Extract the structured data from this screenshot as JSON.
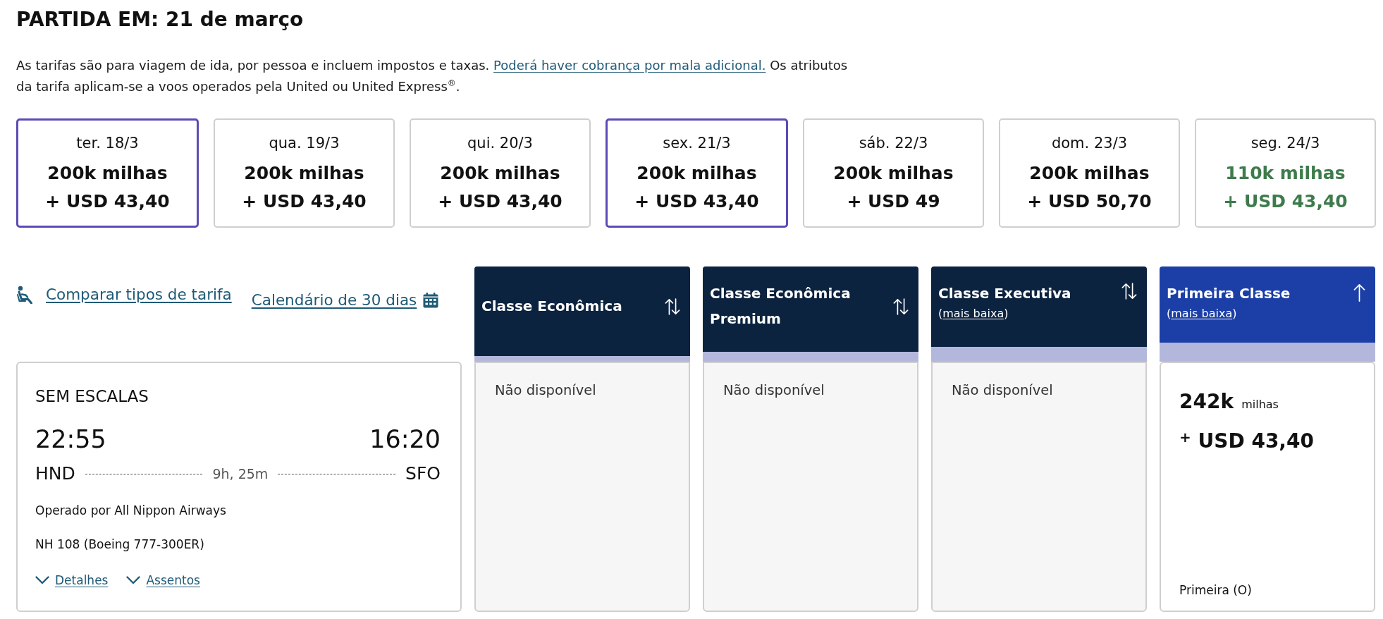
{
  "header": {
    "title": "PARTIDA EM: 21 de março"
  },
  "fare_note": {
    "text": "As tarifas são para viagem de ida, por pessoa e incluem impostos e taxas.",
    "link": "Poderá haver cobrança por mala adicional.",
    "text_after": "Os atributos da tarifa aplicam-se a voos operados pela United ou United Express$^{®}$."
  },
  "date_cards": [
    {
      "day": "ter. 18/3",
      "miles": "200k milhas",
      "price": "+ USD 43,40",
      "selected": true,
      "lowest": false
    },
    {
      "day": "qua. 19/3",
      "miles": "200k milhas",
      "price": "+ USD 43,40",
      "selected": false,
      "lowest": false
    },
    {
      "day": "qui. 20/3",
      "miles": "200k milhas",
      "price": "+ USD 43,40",
      "selected": false,
      "lowest": false
    },
    {
      "day": "sex. 21/3",
      "miles": "200k milhas",
      "price": "+ USD 43,40",
      "selected": true,
      "lowest": false
    },
    {
      "day": "sáb. 22/3",
      "miles": "200k milhas",
      "price": "+ USD 49",
      "selected": false,
      "lowest": false
    },
    {
      "day": "dom. 23/3",
      "miles": "200k milhas",
      "price": "+ USD 50,70",
      "selected": false,
      "lowest": false
    },
    {
      "day": "seg. 24/3",
      "miles": "110k milhas",
      "price": "+ USD 43,40",
      "selected": false,
      "lowest": true
    }
  ],
  "links": {
    "compare": "Comparar tipos de tarifa",
    "calendar": "Calendário de 30 dias"
  },
  "flight": {
    "stops": "SEM ESCALAS",
    "depart_time": "22:55",
    "arrive_time": "16:20",
    "origin": "HND",
    "duration": "9h, 25m",
    "destination": "SFO",
    "operator": "Operado por All Nippon Airways",
    "flight_number": "NH 108 (Boeing 777-300ER)",
    "links": [
      "Detalhes",
      "Assentos"
    ]
  },
  "columns": [
    {
      "title": "Classe Econômica",
      "sorted": false,
      "cell": {
        "kind": "unavailable",
        "text": "Não disponível"
      }
    },
    {
      "title": "Classe Econômica Premium",
      "sorted": false,
      "cell": {
        "kind": "unavailable",
        "text": "Não disponível"
      }
    },
    {
      "title": "Classe Executiva",
      "note": {
        "open": "(",
        "link": "mais baixa",
        "close": ")"
      },
      "sorted": false,
      "cell": {
        "kind": "unavailable",
        "text": "Não disponível"
      }
    },
    {
      "title": "Primeira Classe",
      "note": {
        "open": "(",
        "link": "mais baixa",
        "close": ")"
      },
      "sorted": true,
      "cell": {
        "kind": "fare",
        "miles": "**242k** milhas",
        "price": "$^{+}$ USD 43,40",
        "fare_class": "Primeira (O)"
      }
    }
  ]
}
